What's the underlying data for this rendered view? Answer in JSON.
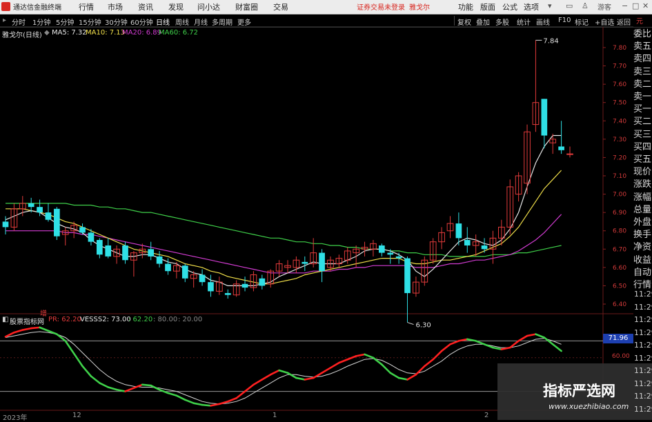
{
  "app": {
    "title": "通达信金融终端",
    "menu": [
      "行情",
      "市场",
      "资讯",
      "发现",
      "问小达",
      "财富圈",
      "交易"
    ],
    "login_status": "证券交易未登录",
    "stock_name": "雅戈尔",
    "right_menu": [
      "功能",
      "版面",
      "公式",
      "选项"
    ],
    "guest": "游客"
  },
  "toolbar": {
    "periods": [
      "分时",
      "1分钟",
      "5分钟",
      "15分钟",
      "30分钟",
      "60分钟",
      "日线",
      "周线",
      "月线",
      "多周期",
      "更多"
    ],
    "right_buttons": [
      "复权",
      "叠加",
      "多股",
      "统计",
      "画线",
      "F10",
      "标记",
      "+自选",
      "返回"
    ]
  },
  "chart": {
    "title": "雅戈尔(日线)",
    "ma": [
      {
        "label": "MA5: 7.32",
        "color": "#e8e8e8"
      },
      {
        "label": "MA10: 7.13",
        "color": "#f2e04a"
      },
      {
        "label": "MA20: 6.89",
        "color": "#d33cd3"
      },
      {
        "label": "MA60: 6.72",
        "color": "#3fd14a"
      }
    ],
    "high_marker": "7.84",
    "low_marker": "6.30",
    "price_ticks": [
      "7.80",
      "7.70",
      "7.60",
      "7.50",
      "7.40",
      "7.30",
      "7.20",
      "7.10",
      "7.00",
      "6.90",
      "6.80",
      "6.70",
      "6.60",
      "6.50",
      "6.40"
    ],
    "top_right_label": "元"
  },
  "side_panel": {
    "items": [
      "委比",
      "卖五",
      "卖四",
      "卖三",
      "卖二",
      "卖一",
      "买一",
      "买二",
      "买三",
      "买四",
      "买五",
      "现价",
      "涨跌",
      "涨幅",
      "总量",
      "外盘",
      "换手",
      "净资",
      "收益",
      "自动",
      "行情"
    ],
    "times": [
      "11:29",
      "11:29",
      "11:29",
      "11:29",
      "11:29",
      "11:29",
      "11:29",
      "11:29",
      "11:29",
      "11:29"
    ]
  },
  "indicator": {
    "name": "股票指标网",
    "zeng": "增",
    "params": [
      {
        "label": "PR: 62.20",
        "color": "#e33b3b"
      },
      {
        "label": "VESSS2: 73.00",
        "color": "#e8e8e8"
      },
      {
        "label": ": 62.20",
        "color": "#3fd14a"
      },
      {
        "label": ": 80.00",
        "color": "#8a8a8a"
      },
      {
        "label": ": 20.00",
        "color": "#8a8a8a"
      }
    ],
    "current_value": "71.96",
    "level_label": "60.00"
  },
  "time_axis": [
    "2023年",
    "12",
    "1",
    "2"
  ],
  "watermark": {
    "brand": "指标严选网",
    "url": "www.xuezhibiao.com"
  },
  "colors": {
    "up": "#e33b3b",
    "down": "#2fe0e6",
    "ma5": "#e8e8e8",
    "ma10": "#f2e04a",
    "ma20": "#d33cd3",
    "ma60": "#3fd14a",
    "indicator_up": "#ff2020",
    "indicator_down": "#3fd14a"
  },
  "chart_data": {
    "type": "candlestick",
    "ylim": [
      6.3,
      7.84
    ],
    "candles": [
      {
        "o": 6.85,
        "h": 6.88,
        "l": 6.78,
        "c": 6.82
      },
      {
        "o": 6.82,
        "h": 6.95,
        "l": 6.8,
        "c": 6.92
      },
      {
        "o": 6.92,
        "h": 6.99,
        "l": 6.88,
        "c": 6.95
      },
      {
        "o": 6.95,
        "h": 6.98,
        "l": 6.9,
        "c": 6.93
      },
      {
        "o": 6.93,
        "h": 6.97,
        "l": 6.88,
        "c": 6.9
      },
      {
        "o": 6.9,
        "h": 6.95,
        "l": 6.85,
        "c": 6.86
      },
      {
        "o": 6.92,
        "h": 6.93,
        "l": 6.75,
        "c": 6.77
      },
      {
        "o": 6.78,
        "h": 6.82,
        "l": 6.72,
        "c": 6.8
      },
      {
        "o": 6.8,
        "h": 6.85,
        "l": 6.76,
        "c": 6.83
      },
      {
        "o": 6.82,
        "h": 6.84,
        "l": 6.78,
        "c": 6.79
      },
      {
        "o": 6.79,
        "h": 6.81,
        "l": 6.72,
        "c": 6.74
      },
      {
        "o": 6.75,
        "h": 6.76,
        "l": 6.65,
        "c": 6.67
      },
      {
        "o": 6.72,
        "h": 6.76,
        "l": 6.65,
        "c": 6.66
      },
      {
        "o": 6.66,
        "h": 6.72,
        "l": 6.62,
        "c": 6.7
      },
      {
        "o": 6.72,
        "h": 6.74,
        "l": 6.62,
        "c": 6.64
      },
      {
        "o": 6.64,
        "h": 6.69,
        "l": 6.55,
        "c": 6.68
      },
      {
        "o": 6.68,
        "h": 6.73,
        "l": 6.65,
        "c": 6.7
      },
      {
        "o": 6.7,
        "h": 6.74,
        "l": 6.64,
        "c": 6.66
      },
      {
        "o": 6.66,
        "h": 6.69,
        "l": 6.6,
        "c": 6.62
      },
      {
        "o": 6.62,
        "h": 6.65,
        "l": 6.56,
        "c": 6.58
      },
      {
        "o": 6.58,
        "h": 6.63,
        "l": 6.54,
        "c": 6.61
      },
      {
        "o": 6.61,
        "h": 6.62,
        "l": 6.52,
        "c": 6.54
      },
      {
        "o": 6.54,
        "h": 6.58,
        "l": 6.49,
        "c": 6.56
      },
      {
        "o": 6.56,
        "h": 6.59,
        "l": 6.5,
        "c": 6.52
      },
      {
        "o": 6.52,
        "h": 6.56,
        "l": 6.44,
        "c": 6.47
      },
      {
        "o": 6.47,
        "h": 6.55,
        "l": 6.45,
        "c": 6.52
      },
      {
        "o": 6.46,
        "h": 6.48,
        "l": 6.43,
        "c": 6.45
      },
      {
        "o": 6.45,
        "h": 6.53,
        "l": 6.44,
        "c": 6.51
      },
      {
        "o": 6.51,
        "h": 6.55,
        "l": 6.47,
        "c": 6.49
      },
      {
        "o": 6.49,
        "h": 6.58,
        "l": 6.47,
        "c": 6.56
      },
      {
        "o": 6.54,
        "h": 6.56,
        "l": 6.48,
        "c": 6.5
      },
      {
        "o": 6.51,
        "h": 6.59,
        "l": 6.49,
        "c": 6.58
      },
      {
        "o": 6.58,
        "h": 6.64,
        "l": 6.55,
        "c": 6.62
      },
      {
        "o": 6.6,
        "h": 6.64,
        "l": 6.57,
        "c": 6.61
      },
      {
        "o": 6.6,
        "h": 6.66,
        "l": 6.57,
        "c": 6.64
      },
      {
        "o": 6.63,
        "h": 6.66,
        "l": 6.58,
        "c": 6.62
      },
      {
        "o": 6.62,
        "h": 6.76,
        "l": 6.6,
        "c": 6.68
      },
      {
        "o": 6.68,
        "h": 6.7,
        "l": 6.52,
        "c": 6.58
      },
      {
        "o": 6.6,
        "h": 6.66,
        "l": 6.58,
        "c": 6.64
      },
      {
        "o": 6.62,
        "h": 6.67,
        "l": 6.6,
        "c": 6.65
      },
      {
        "o": 6.64,
        "h": 6.71,
        "l": 6.62,
        "c": 6.69
      },
      {
        "o": 6.68,
        "h": 6.72,
        "l": 6.6,
        "c": 6.7
      },
      {
        "o": 6.7,
        "h": 6.74,
        "l": 6.66,
        "c": 6.71
      },
      {
        "o": 6.7,
        "h": 6.75,
        "l": 6.66,
        "c": 6.73
      },
      {
        "o": 6.72,
        "h": 6.73,
        "l": 6.66,
        "c": 6.68
      },
      {
        "o": 6.68,
        "h": 6.7,
        "l": 6.62,
        "c": 6.67
      },
      {
        "o": 6.66,
        "h": 6.68,
        "l": 6.62,
        "c": 6.65
      },
      {
        "o": 6.65,
        "h": 6.66,
        "l": 6.3,
        "c": 6.46
      },
      {
        "o": 6.46,
        "h": 6.55,
        "l": 6.44,
        "c": 6.52
      },
      {
        "o": 6.52,
        "h": 6.66,
        "l": 6.5,
        "c": 6.64
      },
      {
        "o": 6.64,
        "h": 6.76,
        "l": 6.62,
        "c": 6.74
      },
      {
        "o": 6.74,
        "h": 6.82,
        "l": 6.7,
        "c": 6.79
      },
      {
        "o": 6.8,
        "h": 6.88,
        "l": 6.76,
        "c": 6.84
      },
      {
        "o": 6.84,
        "h": 6.9,
        "l": 6.72,
        "c": 6.76
      },
      {
        "o": 6.75,
        "h": 6.82,
        "l": 6.68,
        "c": 6.72
      },
      {
        "o": 6.72,
        "h": 6.78,
        "l": 6.66,
        "c": 6.74
      },
      {
        "o": 6.72,
        "h": 6.76,
        "l": 6.68,
        "c": 6.7
      },
      {
        "o": 6.7,
        "h": 6.8,
        "l": 6.62,
        "c": 6.76
      },
      {
        "o": 6.76,
        "h": 6.86,
        "l": 6.72,
        "c": 6.82
      },
      {
        "o": 6.82,
        "h": 7.08,
        "l": 6.78,
        "c": 7.04
      },
      {
        "o": 7.0,
        "h": 7.12,
        "l": 6.96,
        "c": 7.1
      },
      {
        "o": 7.06,
        "h": 7.38,
        "l": 7.0,
        "c": 7.34
      },
      {
        "o": 7.38,
        "h": 7.84,
        "l": 7.34,
        "c": 7.5
      },
      {
        "o": 7.52,
        "h": 7.52,
        "l": 7.25,
        "c": 7.32
      },
      {
        "o": 7.28,
        "h": 7.33,
        "l": 7.22,
        "c": 7.3
      },
      {
        "o": 7.26,
        "h": 7.4,
        "l": 7.22,
        "c": 7.24
      },
      {
        "o": 7.22,
        "h": 7.26,
        "l": 7.2,
        "c": 7.22
      }
    ],
    "ma5": [
      6.86,
      6.88,
      6.9,
      6.91,
      6.9,
      6.87,
      6.84,
      6.82,
      6.81,
      6.79,
      6.75,
      6.72,
      6.7,
      6.68,
      6.66,
      6.66,
      6.67,
      6.67,
      6.65,
      6.63,
      6.62,
      6.59,
      6.57,
      6.56,
      6.53,
      6.52,
      6.5,
      6.5,
      6.5,
      6.5,
      6.51,
      6.52,
      6.55,
      6.57,
      6.59,
      6.61,
      6.63,
      6.62,
      6.62,
      6.62,
      6.64,
      6.66,
      6.69,
      6.7,
      6.7,
      6.69,
      6.67,
      6.64,
      6.58,
      6.55,
      6.59,
      6.64,
      6.69,
      6.74,
      6.76,
      6.75,
      6.73,
      6.72,
      6.75,
      6.81,
      6.9,
      7.04,
      7.17,
      7.26,
      7.32,
      7.32
    ],
    "ma10": [
      6.92,
      6.92,
      6.92,
      6.91,
      6.9,
      6.89,
      6.87,
      6.85,
      6.84,
      6.82,
      6.8,
      6.78,
      6.76,
      6.74,
      6.72,
      6.7,
      6.69,
      6.68,
      6.67,
      6.66,
      6.64,
      6.62,
      6.61,
      6.6,
      6.58,
      6.57,
      6.55,
      6.54,
      6.53,
      6.52,
      6.51,
      6.51,
      6.52,
      6.53,
      6.54,
      6.56,
      6.57,
      6.58,
      6.59,
      6.6,
      6.61,
      6.62,
      6.63,
      6.64,
      6.65,
      6.65,
      6.65,
      6.63,
      6.62,
      6.62,
      6.63,
      6.64,
      6.64,
      6.65,
      6.66,
      6.67,
      6.69,
      6.71,
      6.73,
      6.77,
      6.82,
      6.89,
      6.96,
      7.03,
      7.08,
      7.13
    ],
    "ma20": [
      6.8,
      6.8,
      6.8,
      6.8,
      6.8,
      6.8,
      6.8,
      6.79,
      6.79,
      6.78,
      6.78,
      6.77,
      6.76,
      6.75,
      6.74,
      6.73,
      6.72,
      6.71,
      6.7,
      6.69,
      6.68,
      6.67,
      6.66,
      6.65,
      6.64,
      6.63,
      6.62,
      6.61,
      6.6,
      6.59,
      6.58,
      6.57,
      6.57,
      6.57,
      6.57,
      6.57,
      6.58,
      6.58,
      6.58,
      6.59,
      6.59,
      6.6,
      6.6,
      6.61,
      6.61,
      6.61,
      6.61,
      6.61,
      6.6,
      6.6,
      6.6,
      6.61,
      6.62,
      6.62,
      6.63,
      6.64,
      6.64,
      6.65,
      6.66,
      6.67,
      6.69,
      6.72,
      6.75,
      6.79,
      6.84,
      6.89
    ],
    "ma60": [
      6.95,
      6.95,
      6.95,
      6.95,
      6.95,
      6.95,
      6.95,
      6.95,
      6.94,
      6.94,
      6.94,
      6.93,
      6.93,
      6.92,
      6.92,
      6.91,
      6.9,
      6.9,
      6.89,
      6.88,
      6.87,
      6.86,
      6.85,
      6.84,
      6.83,
      6.82,
      6.81,
      6.8,
      6.79,
      6.78,
      6.77,
      6.76,
      6.76,
      6.75,
      6.74,
      6.74,
      6.73,
      6.73,
      6.72,
      6.72,
      6.71,
      6.71,
      6.7,
      6.7,
      6.7,
      6.69,
      6.69,
      6.68,
      6.68,
      6.67,
      6.67,
      6.67,
      6.66,
      6.66,
      6.66,
      6.66,
      6.66,
      6.67,
      6.67,
      6.67,
      6.68,
      6.68,
      6.69,
      6.7,
      6.71,
      6.72
    ],
    "indicator_ylim": [
      0,
      100
    ],
    "indicator_pr": [
      85,
      90,
      93,
      95,
      96,
      92,
      88,
      80,
      65,
      50,
      38,
      30,
      25,
      22,
      20,
      24,
      28,
      27,
      22,
      18,
      15,
      10,
      6,
      4,
      3,
      5,
      8,
      12,
      20,
      28,
      34,
      40,
      45,
      42,
      36,
      34,
      36,
      42,
      48,
      54,
      58,
      62,
      64,
      60,
      52,
      42,
      36,
      34,
      40,
      50,
      58,
      68,
      76,
      80,
      82,
      80,
      76,
      72,
      70,
      72,
      80,
      86,
      88,
      84,
      76,
      68
    ],
    "indicator_vess": [
      84,
      86,
      88,
      90,
      91,
      90,
      88,
      84,
      76,
      66,
      56,
      46,
      38,
      32,
      28,
      26,
      25,
      25,
      24,
      22,
      20,
      16,
      12,
      8,
      6,
      5,
      6,
      8,
      12,
      18,
      24,
      30,
      36,
      40,
      40,
      38,
      37,
      38,
      41,
      45,
      50,
      54,
      58,
      59,
      57,
      52,
      46,
      42,
      41,
      44,
      50,
      56,
      64,
      70,
      74,
      76,
      76,
      74,
      72,
      72,
      74,
      78,
      82,
      83,
      80,
      76
    ]
  }
}
